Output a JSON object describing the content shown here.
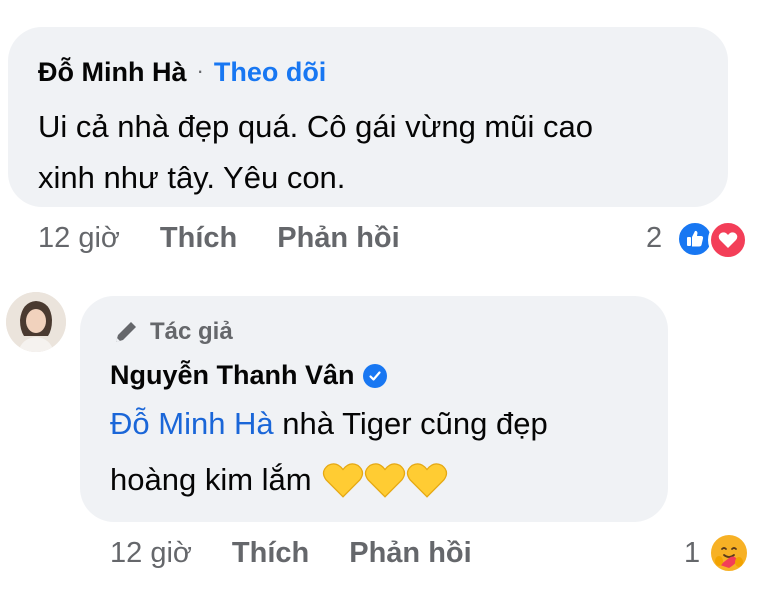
{
  "comment1": {
    "author": "Đỗ Minh Hà",
    "separator": "·",
    "follow_label": "Theo dõi",
    "text_line1": "Ui cả nhà đẹp quá. Cô gái vừng mũi cao",
    "text_line2": "xinh như tây. Yêu con.",
    "time": "12 giờ",
    "like_label": "Thích",
    "reply_label": "Phản hồi",
    "reaction_count": "2",
    "reactions": [
      "like-icon",
      "love-icon"
    ],
    "colors": {
      "like": "#1877f2",
      "love": "#f33e58"
    }
  },
  "reply1": {
    "badge": "Tác giả",
    "author": "Nguyễn Thanh Vân",
    "mention": "Đỗ Minh Hà",
    "text_line1_rest": " nhà Tiger cũng đẹp",
    "text_line2": "hoàng kim lắm",
    "hearts": [
      "yellow-heart-icon",
      "yellow-heart-icon",
      "yellow-heart-icon"
    ],
    "time": "12 giờ",
    "like_label": "Thích",
    "reply_label": "Phản hồi",
    "reaction_count": "1",
    "reactions": [
      "care-icon"
    ],
    "colors": {
      "mention": "#1a66d8",
      "heart": "#ffcc33",
      "verified": "#1877f2"
    }
  }
}
